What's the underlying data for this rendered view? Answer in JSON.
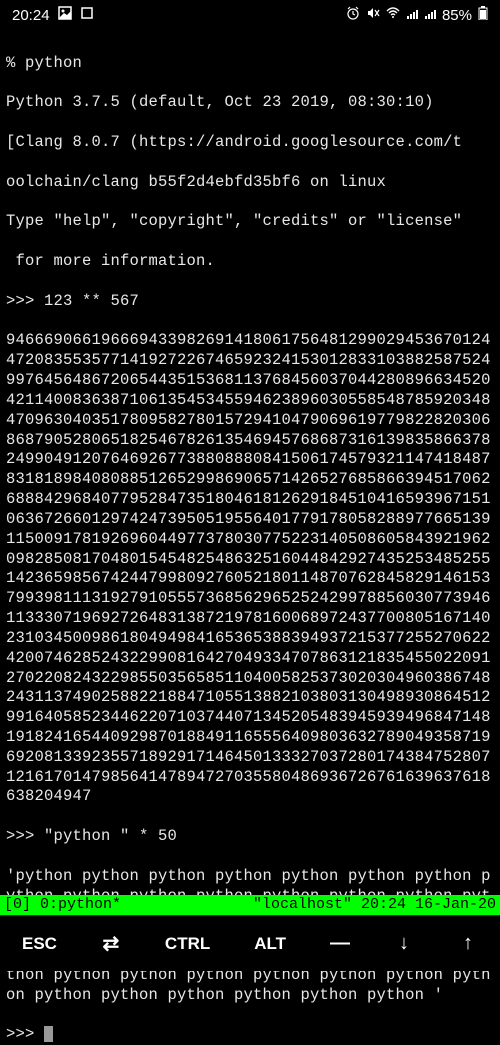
{
  "status": {
    "time": "20:24",
    "battery": "85%",
    "icons": {
      "image": "🖼",
      "square": "▢",
      "alarm": "⏰",
      "mute": "🔇",
      "wifi": "📶",
      "signal1": "📶",
      "signal2": "📶",
      "battery_icon": "▮"
    }
  },
  "terminal": {
    "shell_prompt": "% python",
    "python_version": "Python 3.7.5 (default, Oct 23 2019, 08:30:10)",
    "compiler_line1": "[Clang 8.0.7 (https://android.googlesource.com/t",
    "compiler_line2": "oolchain/clang b55f2d4ebfd35bf6 on linux",
    "help_line1": "Type \"help\", \"copyright\", \"credits\" or \"license\"",
    "help_line2": " for more information.",
    "prompt1": ">>> 123 ** 567",
    "big_number": "946669066196669433982691418061756481299029453670124472083553577141927226746592324153012833103882587524997645648672065443515368113768456037044280896634520421140083638710613545345594623896030558548785920348470963040351780958278015729410479069619779822820306868790528065182546782613546945768687316139835866378249904912076469267738808880841506174579321147418487831818984080885126529986906571426527685866394517062688842968407795284735180461812629184510416593967151063672660129742473950519556401779178058288977665139115009178192696044977378030775223140508605843921962098285081704801545482548632516044842927435253485255142365985674244799809276052180114870762845829146153799398111319279105557368562965252429978856030773946113330719692726483138721978160068972437700805167140231034500986180494984165365388394937215377255270622420074628524322990816427049334707863121835455022091270220824322985503565851104005825373020304960386748243113749025882218847105513882103803130498930864512991640585234462207103744071345205483945939496847148191824165440929870188491165556409803632789049358719692081339235571892917146450133327037280174384752807121617014798564147894727035580486936726761639637618638204947",
    "prompt2": ">>> \"python \" * 50",
    "string_result": "'python python python python python python python python python python python python python python python python python python python python python python python python python python python python python python python python python python python python python python python python python python python python python python python python python python '",
    "prompt3": ">>> "
  },
  "tmux": {
    "left": "[0] 0:python*",
    "right": "\"localhost\" 20:24 16-Jan-20"
  },
  "keyboard": {
    "esc": "ESC",
    "tab": "⇄",
    "ctrl": "CTRL",
    "alt": "ALT",
    "dash": "—",
    "down": "↓",
    "up": "↑"
  }
}
